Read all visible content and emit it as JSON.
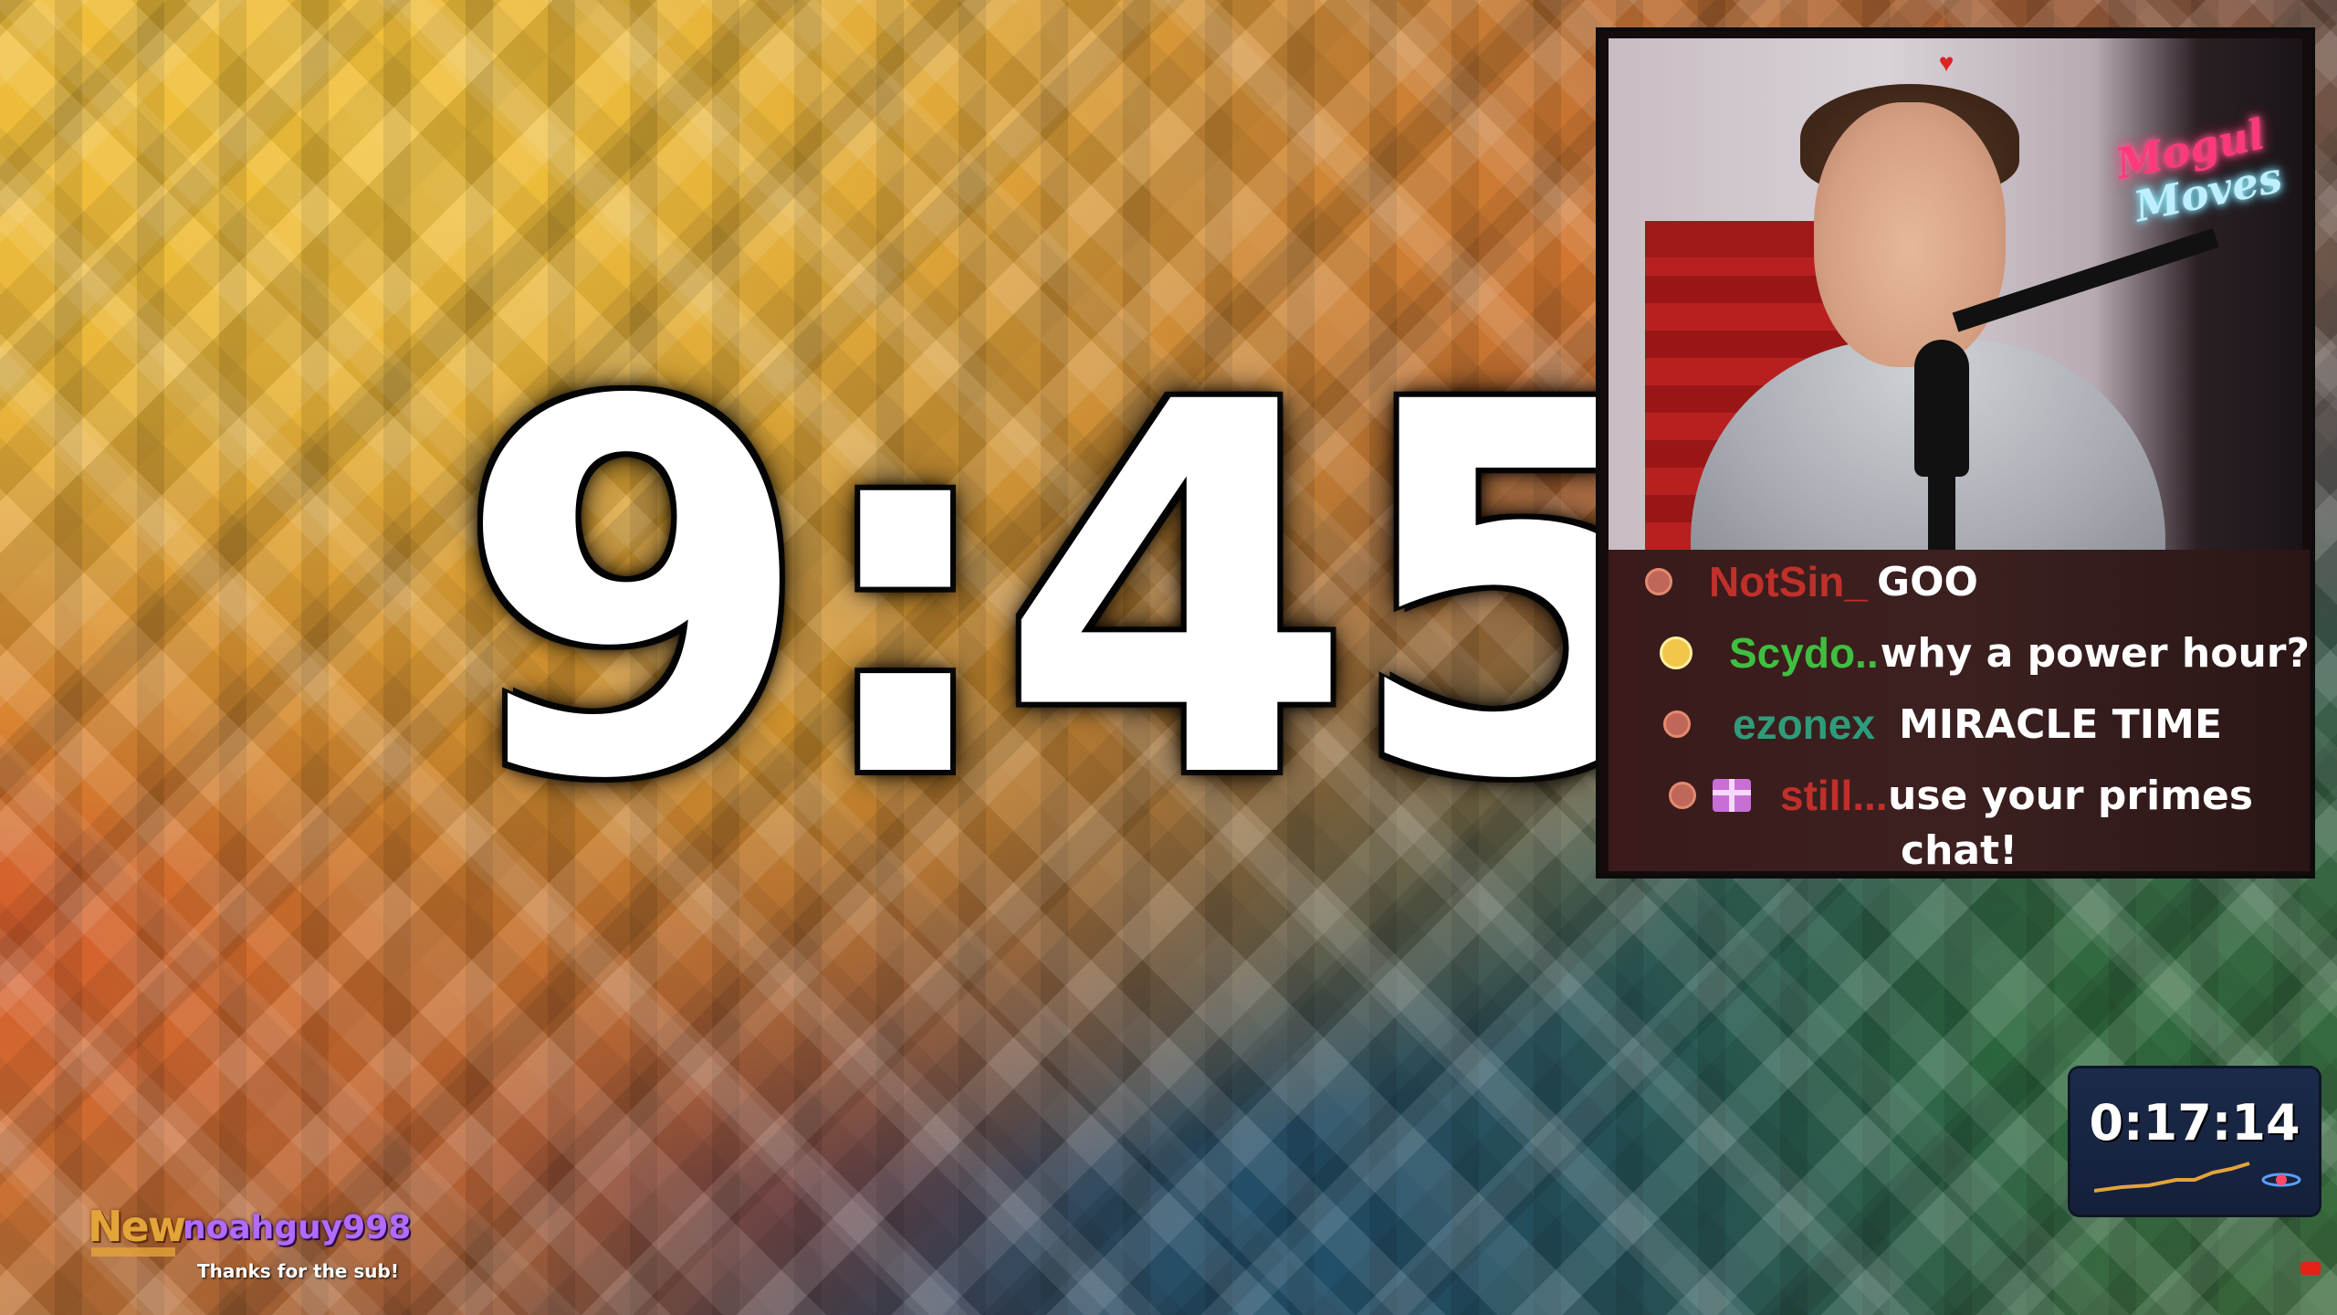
{
  "countdown": {
    "value": "9:45"
  },
  "webcam": {
    "neon_sign_line1": "Mogul",
    "neon_sign_line2": "Moves"
  },
  "chat": {
    "messages": [
      {
        "user": "NotSin_",
        "user_color": "#c0302a",
        "badge": "circle",
        "text": "GOO"
      },
      {
        "user": "Scydo...",
        "user_color": "#3fbf3f",
        "badge": "sun",
        "text": "why a power hour?"
      },
      {
        "user": "ezonex",
        "user_color": "#2e9c7a",
        "badge": "circle",
        "text": "MIRACLE TIME"
      },
      {
        "user": "still...",
        "user_color": "#c0302a",
        "badge": "circle+gift",
        "text": "use your primes",
        "text_line2": "chat!"
      }
    ]
  },
  "sub_alert": {
    "label": "New",
    "username": "noahguy998",
    "thanks": "Thanks for the sub!"
  },
  "stream_timer": {
    "value": "0:17:14"
  },
  "colors": {
    "countdown": "#ffffff",
    "chat_bg": "#3a1a1a",
    "sub_name": "#b16bff",
    "timer_bg": "#1b2a4a"
  }
}
